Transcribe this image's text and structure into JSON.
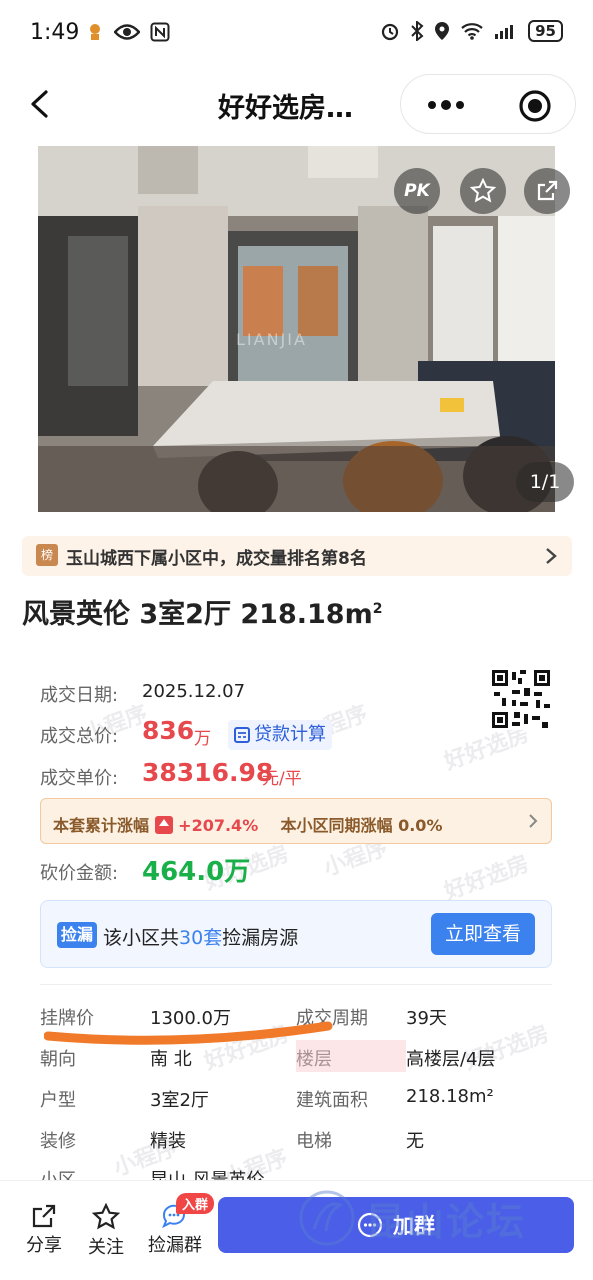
{
  "status_bar": {
    "time": "1:49",
    "battery": "95"
  },
  "nav": {
    "title": "好好选房…"
  },
  "photo": {
    "watermark": "LIANJIA",
    "pk_label": "PK",
    "counter": "1/1"
  },
  "ranking": {
    "badge": "榜",
    "text": "玉山城西下属小区中，成交量排名第8名"
  },
  "listing": {
    "title": "风景英伦 3室2厅 218.18m",
    "title_sup": "2"
  },
  "deal": {
    "date_label": "成交日期:",
    "date_value": "2025.12.07",
    "total_label": "成交总价:",
    "total_value": "836",
    "total_unit": "万",
    "loan_calc": "贷款计算",
    "unit_label": "成交单价:",
    "unit_value": "38316.98",
    "unit_unit": "元/平",
    "rise_label": "本套累计涨幅",
    "rise_pct": "+207.4%",
    "community_rise_label": "本小区同期涨幅",
    "community_rise_pct": "0.0%",
    "bargain_label": "砍价金额:",
    "bargain_value": "464.0万"
  },
  "leak": {
    "badge": "捡漏",
    "text_pre": "该小区共",
    "count": "30套",
    "text_post": "捡漏房源",
    "button": "立即查看"
  },
  "details": [
    {
      "label": "挂牌价",
      "value": "1300.0万"
    },
    {
      "label": "成交周期",
      "value": "39天"
    },
    {
      "label": "朝向",
      "value": "南 北"
    },
    {
      "label": "楼层",
      "value": "高楼层/4层"
    },
    {
      "label": "户型",
      "value": "3室2厅"
    },
    {
      "label": "建筑面积",
      "value": "218.18m²"
    },
    {
      "label": "装修",
      "value": "精装"
    },
    {
      "label": "电梯",
      "value": "无"
    },
    {
      "label": "小区",
      "value": "昆山-风景英伦"
    }
  ],
  "watermarks": {
    "app": "好好选房",
    "mini": "小程序",
    "forum": "昆山论坛"
  },
  "bottom_bar": {
    "share": "分享",
    "follow": "关注",
    "leak_group": "捡漏群",
    "join_badge": "入群",
    "join_button": "加群"
  },
  "colors": {
    "accent_blue": "#3c82ee",
    "price_red": "#e6484c",
    "bargain_green": "#19b04a",
    "join_button": "#4a5ee8"
  }
}
